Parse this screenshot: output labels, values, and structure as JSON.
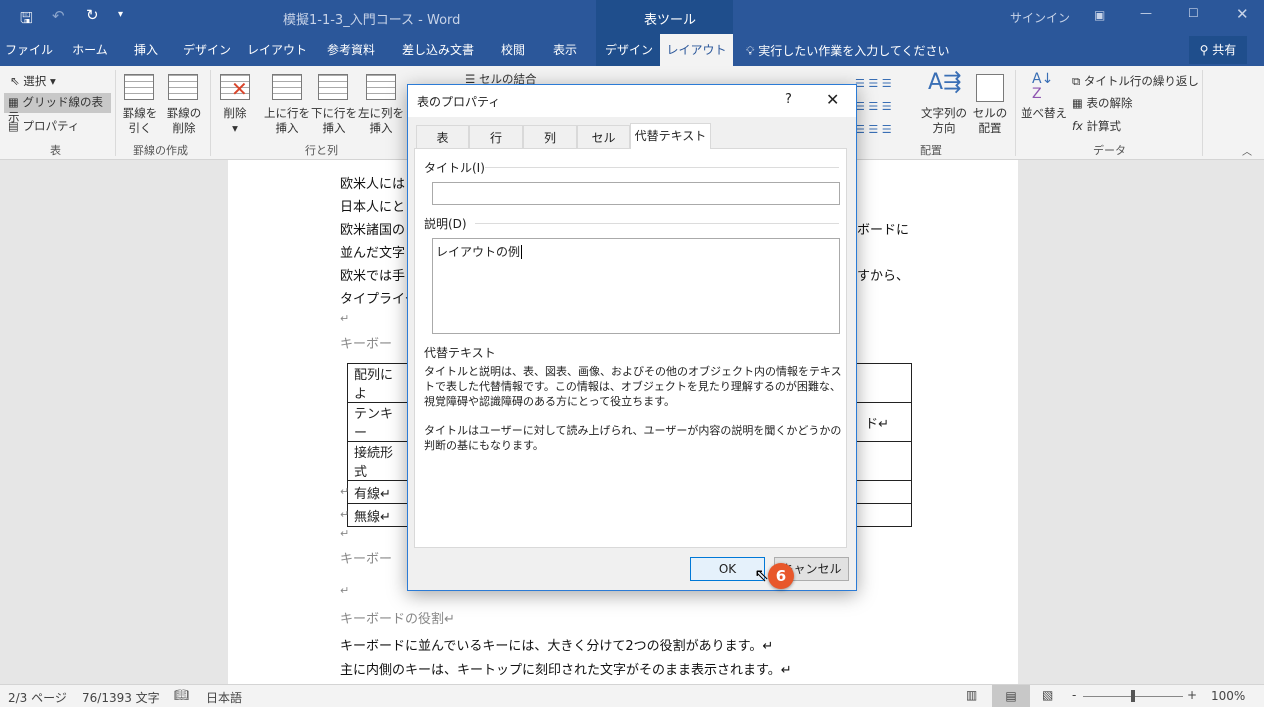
{
  "window": {
    "title": "模擬1-1-3_入門コース - Word",
    "context_tab": "表ツール",
    "signin": "サインイン",
    "share": "共有"
  },
  "ribbon_tabs": [
    "ファイル",
    "ホーム",
    "挿入",
    "デザイン",
    "レイアウト",
    "参考資料",
    "差し込み文書",
    "校閲",
    "表示",
    "デザイン",
    "レイアウト"
  ],
  "tell_me": "実行したい作業を入力してください",
  "ribbon": {
    "select": "選択",
    "gridlines": "グリッド線の表示",
    "properties": "プロパティ",
    "group_table": "表",
    "draw_table": [
      "罫線を",
      "引く"
    ],
    "eraser": [
      "罫線の",
      "削除"
    ],
    "group_draw": "罫線の作成",
    "delete": "削除",
    "insert_above": [
      "上に行を",
      "挿入"
    ],
    "insert_below": [
      "下に行を",
      "挿入"
    ],
    "insert_left": [
      "左に列を",
      "挿入"
    ],
    "group_rows": "行と列",
    "merge": "セルの結合",
    "text_direction": [
      "文字列の",
      "方向"
    ],
    "cell_margins": [
      "セルの",
      "配置"
    ],
    "group_align": "配置",
    "sort": "並べ替え",
    "repeat_header": "タイトル行の繰り返し",
    "convert": "表の解除",
    "formula": "計算式",
    "group_data": "データ"
  },
  "document": {
    "lines": [
      "欧米人には",
      "日本人にと",
      "欧米諸国の",
      "並んだ文字",
      "欧米では手",
      "タイプライタ"
    ],
    "right_fragments": [
      "ボードに",
      "すから、"
    ],
    "heading1": "キーボー",
    "table_rows": [
      "配列によ",
      "テンキー",
      "接続形式",
      "有線↵",
      "無線↵"
    ],
    "table_row2_right": "ド↵",
    "heading2": "キーボー",
    "heading3": "キーボードの役割↵",
    "body": [
      "キーボードに並んでいるキーには、大きく分けて2つの役割があります。↵",
      "主に内側のキーは、キートップに刻印された文字がそのまま表示されます。↵"
    ],
    "return_mark": "↵"
  },
  "dialog": {
    "title": "表のプロパティ",
    "help": "?",
    "tabs": [
      "表",
      "行",
      "列",
      "セル",
      "代替テキスト"
    ],
    "active_tab": 4,
    "title_label": "タイトル(I)",
    "title_value": "",
    "desc_label": "説明(D)",
    "desc_value": "レイアウトの例",
    "alt_heading": "代替テキスト",
    "alt_p1": "タイトルと説明は、表、図表、画像、およびその他のオブジェクト内の情報をテキストで表した代替情報です。この情報は、オブジェクトを見たり理解するのが困難な、視覚障碍や認識障碍のある方にとって役立ちます。",
    "alt_p2": "タイトルはユーザーに対して読み上げられ、ユーザーが内容の説明を聞くかどうかの判断の基にもなります。",
    "ok": "OK",
    "cancel": "キャンセル"
  },
  "step_badge": "6",
  "status": {
    "page": "2/3 ページ",
    "words": "76/1393 文字",
    "language": "日本語",
    "zoom": "100%",
    "zoom_level_percent": 100
  },
  "colors": {
    "brand": "#2b579a",
    "badge": "#e8572a",
    "dialog_border": "#2b7bd6"
  }
}
